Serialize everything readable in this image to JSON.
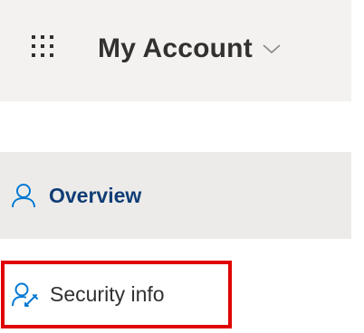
{
  "header": {
    "title": "My Account",
    "menu_icon": "waffle-icon",
    "dropdown_icon": "chevron-down-icon"
  },
  "nav": {
    "items": [
      {
        "label": "Overview",
        "icon": "person-icon",
        "selected": true
      },
      {
        "label": "Security info",
        "icon": "person-key-icon",
        "selected": false,
        "highlighted": true
      }
    ]
  },
  "colors": {
    "header_bg": "#f3f2f1",
    "selected_bg": "#edebe9",
    "accent": "#0078d4",
    "selected_text": "#0f3d75",
    "highlight_border": "#e00000"
  }
}
